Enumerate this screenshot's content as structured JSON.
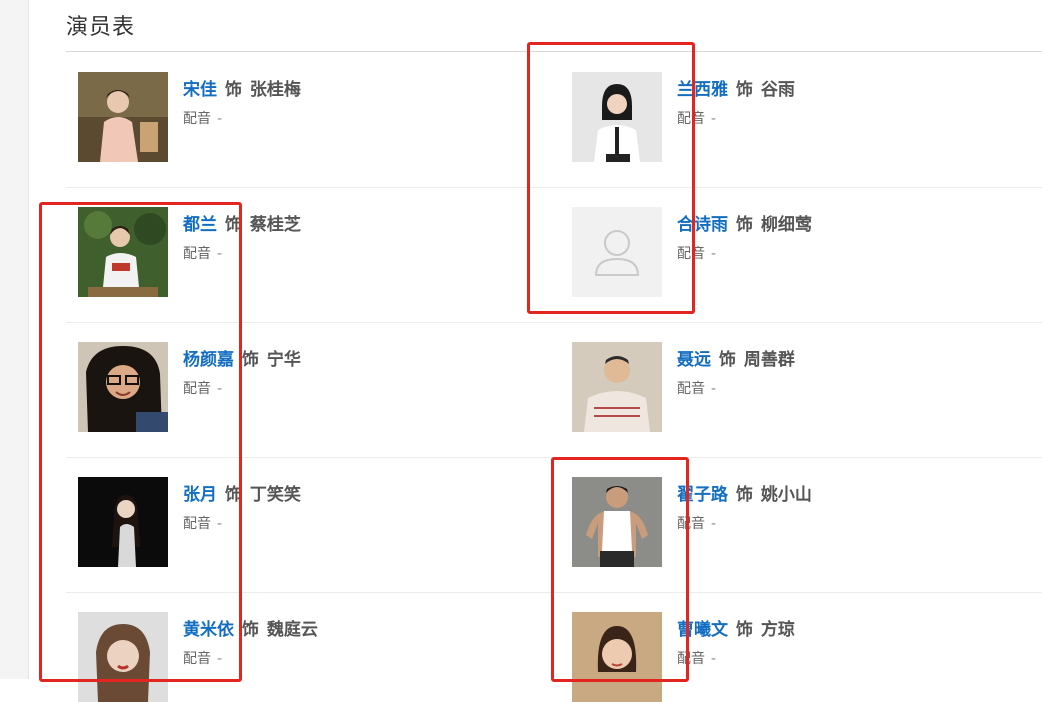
{
  "section": {
    "title": "演员表"
  },
  "cast": [
    {
      "actor": "宋佳",
      "conj": "饰",
      "role": "张桂梅",
      "dub_label": "配音",
      "dub_value": "-",
      "photo_bg": "#6b5a3e"
    },
    {
      "actor": "兰西雅",
      "conj": "饰",
      "role": "谷雨",
      "dub_label": "配音",
      "dub_value": "-",
      "photo_bg": "#e9e9e9"
    },
    {
      "actor": "都兰",
      "conj": "饰",
      "role": "蔡桂芝",
      "dub_label": "配音",
      "dub_value": "-",
      "photo_bg": "#4d6b38"
    },
    {
      "actor": "合诗雨",
      "conj": "饰",
      "role": "柳细莺",
      "dub_label": "配音",
      "dub_value": "-",
      "photo_bg": "#f1f1f1"
    },
    {
      "actor": "杨颜嘉",
      "conj": "饰",
      "role": "宁华",
      "dub_label": "配音",
      "dub_value": "-",
      "photo_bg": "#d9d1c4"
    },
    {
      "actor": "聂远",
      "conj": "饰",
      "role": "周善群",
      "dub_label": "配音",
      "dub_value": "-",
      "photo_bg": "#d2c8b8"
    },
    {
      "actor": "张月",
      "conj": "饰",
      "role": "丁笑笑",
      "dub_label": "配音",
      "dub_value": "-",
      "photo_bg": "#0d0d0d"
    },
    {
      "actor": "翟子路",
      "conj": "饰",
      "role": "姚小山",
      "dub_label": "配音",
      "dub_value": "-",
      "photo_bg": "#8a8a86"
    },
    {
      "actor": "黄米依",
      "conj": "饰",
      "role": "魏庭云",
      "dub_label": "配音",
      "dub_value": "-",
      "photo_bg": "#dcdcdc"
    },
    {
      "actor": "曹曦文",
      "conj": "饰",
      "role": "方琼",
      "dub_label": "配音",
      "dub_value": "-",
      "photo_bg": "#c9a982"
    }
  ],
  "colors": {
    "actor_link": "#136ec2",
    "highlight_box": "#e2261f"
  }
}
